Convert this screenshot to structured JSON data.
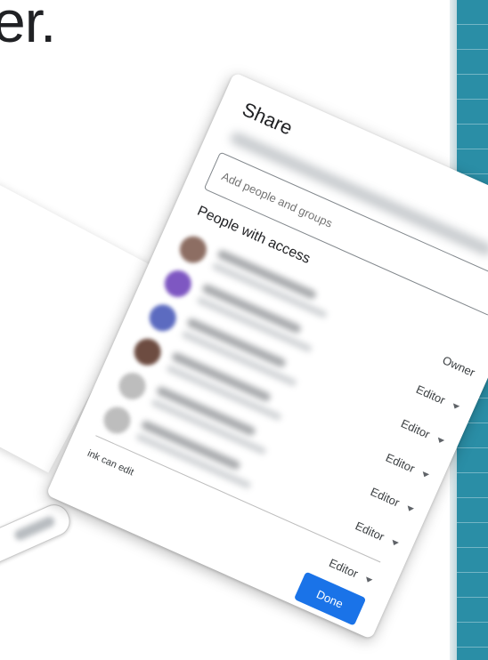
{
  "headline": "er.",
  "dialog": {
    "title": "Share",
    "add_placeholder": "Add people and groups",
    "section_title": "People with access",
    "people": [
      {
        "role": "Owner",
        "has_dropdown": false,
        "avatar_color": "#8d6e63"
      },
      {
        "role": "Editor",
        "has_dropdown": true,
        "avatar_color": "#7e57c2"
      },
      {
        "role": "Editor",
        "has_dropdown": true,
        "avatar_color": "#5c6bc0"
      },
      {
        "role": "Editor",
        "has_dropdown": true,
        "avatar_color": "#6d4c41"
      },
      {
        "role": "Editor",
        "has_dropdown": true,
        "avatar_color": "#bdbdbd"
      },
      {
        "role": "Editor",
        "has_dropdown": true,
        "avatar_color": "#bdbdbd"
      }
    ],
    "link_text": "ink can edit",
    "link_role": "Editor",
    "done_label": "Done",
    "help_icon": "?"
  },
  "colors": {
    "accent": "#1a73e8",
    "teal": "#2a8ea6"
  }
}
